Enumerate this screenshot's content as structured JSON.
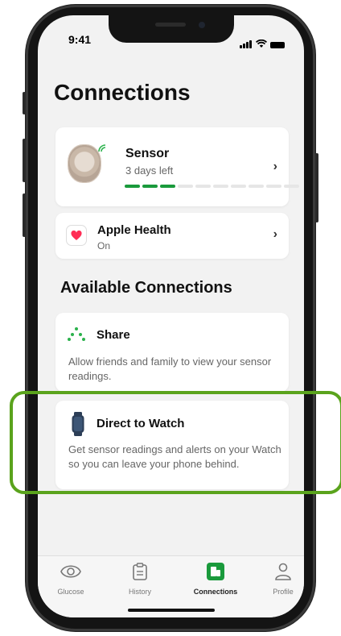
{
  "status_bar": {
    "time": "9:41"
  },
  "page_title": "Connections",
  "sensor_card": {
    "title": "Sensor",
    "subtitle": "3 days left",
    "progress_segments_filled": 3,
    "progress_segments_total": 10
  },
  "health_card": {
    "title": "Apple Health",
    "subtitle": "On"
  },
  "available_section": {
    "title": "Available Connections"
  },
  "share_card": {
    "title": "Share",
    "description": "Allow friends and family to view your sensor readings."
  },
  "watch_card": {
    "title": "Direct to Watch",
    "description": "Get sensor readings and alerts on your Watch so you can leave your phone behind."
  },
  "tab_bar": {
    "tabs": [
      {
        "label": "Glucose",
        "icon": "glucose-icon"
      },
      {
        "label": "History",
        "icon": "history-icon"
      },
      {
        "label": "Connections",
        "icon": "connections-icon"
      },
      {
        "label": "Profile",
        "icon": "profile-icon"
      }
    ]
  },
  "colors": {
    "accent_green": "#1a9a3c",
    "highlight_green": "#5aa31c",
    "health_pink": "#ff2d55"
  }
}
